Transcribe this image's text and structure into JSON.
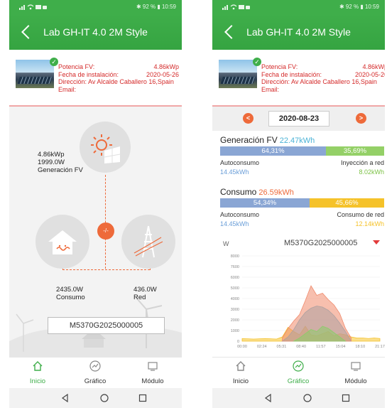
{
  "app_title": "Lab GH-IT 4.0 2M Style",
  "status": {
    "left_icons": "signal wifi mail battery",
    "right_text_1": "✱ 92 % ▮ 10:59",
    "right_text_2": "✱ 92 % ▮ 10:59"
  },
  "plant_info": {
    "rows": [
      {
        "label": "Potencia FV:",
        "value": "4.86kWp"
      },
      {
        "label": "Fecha de instalación:",
        "value": "2020-05-26"
      },
      {
        "label": "Dirección:  Av Alcalde Caballero 16,Spain",
        "value": ""
      },
      {
        "label": "Email:",
        "value": ""
      }
    ]
  },
  "flow": {
    "pv_power": "4.86kWp",
    "pv_current": "1999.0W",
    "pv_label": "Generación FV",
    "center_symbol": "-/-",
    "consumption_value": "2435.0W",
    "consumption_label": "Consumo",
    "grid_value": "436.0W",
    "grid_label": "Red",
    "serial": "M5370G2025000005"
  },
  "nav": [
    {
      "label": "Inicio",
      "icon": "home-icon"
    },
    {
      "label": "Gráfico",
      "icon": "chart-icon"
    },
    {
      "label": "Módulo",
      "icon": "module-icon"
    }
  ],
  "stats": {
    "date": "2020-08-23",
    "generation": {
      "title": "Generación FV",
      "total": "22.47kWh",
      "self_pct": "64,31%",
      "export_pct": "35,69%",
      "self_fraction": 0.6431,
      "self_label": "Autoconsumo",
      "export_label": "Inyección a red",
      "self_value": "14.45kWh",
      "export_value": "8.02kWh"
    },
    "consumption": {
      "title": "Consumo",
      "total": "26.59kWh",
      "self_pct": "54,34%",
      "grid_pct": "45,66%",
      "self_fraction": 0.5434,
      "self_label": "Autoconsumo",
      "grid_label": "Consumo de red",
      "self_value": "14.45kWh",
      "grid_value": "12.14kWh"
    }
  },
  "chart_data": {
    "type": "area",
    "ylabel": "W",
    "serial": "M5370G2025000005",
    "ylim": [
      0,
      8000
    ],
    "y_ticks": [
      "8000",
      "7600",
      "6000",
      "5000",
      "4000",
      "3000",
      "2000",
      "1000",
      "0"
    ],
    "x_ticks": [
      "00:00",
      "02:24",
      "05:31",
      "08:40",
      "11:57",
      "15:04",
      "18:10",
      "21:17"
    ],
    "colors": {
      "consumption": "#f08a6c",
      "pv": "#5dbbe0",
      "self": "#b89ee0",
      "grid": "#f5c22a",
      "export": "#8ccc6a"
    },
    "series": [
      {
        "color": "#f5c22a",
        "x": [
          0,
          2,
          4,
          6,
          7,
          8,
          9,
          10,
          11,
          12,
          13,
          14,
          15,
          16,
          17,
          18,
          19,
          20,
          21,
          22,
          23,
          24
        ],
        "values": [
          250,
          200,
          250,
          200,
          400,
          1300,
          900,
          600,
          1400,
          600,
          500,
          700,
          900,
          500,
          700,
          600,
          400,
          300,
          300,
          250,
          300,
          250
        ]
      },
      {
        "color": "#5dbbe0",
        "x": [
          7,
          8,
          9,
          10,
          11,
          12,
          13,
          14,
          15,
          16,
          17,
          18,
          19
        ],
        "values": [
          0,
          400,
          1100,
          2000,
          2700,
          3100,
          3300,
          3200,
          2900,
          2400,
          1700,
          900,
          0
        ]
      },
      {
        "color": "#f08a6c",
        "x": [
          7,
          8,
          9,
          10,
          11,
          12,
          13,
          14,
          15,
          16,
          17,
          18,
          19
        ],
        "values": [
          300,
          1200,
          1900,
          2500,
          3800,
          5200,
          4300,
          4500,
          3900,
          3400,
          2600,
          1200,
          300
        ]
      },
      {
        "color": "#8ccc6a",
        "x": [
          9,
          10,
          11,
          12,
          13,
          14,
          15,
          16,
          17,
          18
        ],
        "values": [
          0,
          300,
          700,
          1100,
          900,
          1400,
          1200,
          800,
          400,
          0
        ]
      }
    ]
  }
}
